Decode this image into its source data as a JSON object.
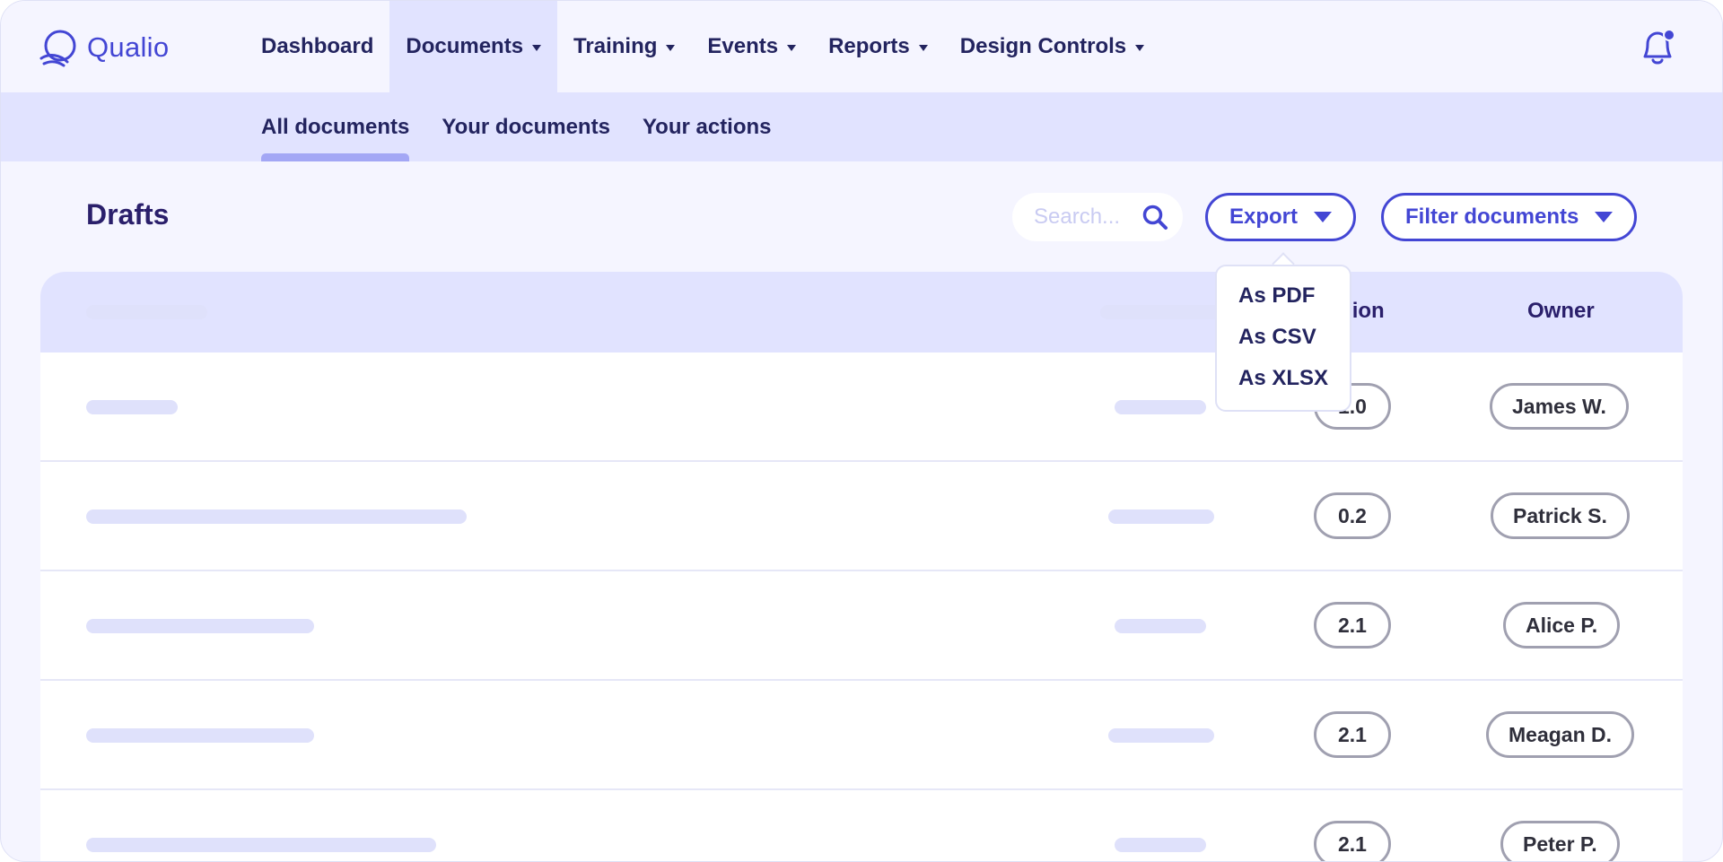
{
  "brand": {
    "name": "Qualio"
  },
  "nav": {
    "items": [
      {
        "label": "Dashboard",
        "has_caret": false,
        "active": false
      },
      {
        "label": "Documents",
        "has_caret": true,
        "active": true
      },
      {
        "label": "Training",
        "has_caret": true,
        "active": false
      },
      {
        "label": "Events",
        "has_caret": true,
        "active": false
      },
      {
        "label": "Reports",
        "has_caret": true,
        "active": false
      },
      {
        "label": "Design Controls",
        "has_caret": true,
        "active": false
      }
    ],
    "notification_icon": "bell-icon"
  },
  "subnav": {
    "tabs": [
      {
        "label": "All documents",
        "active": true
      },
      {
        "label": "Your documents",
        "active": false
      },
      {
        "label": "Your actions",
        "active": false
      }
    ]
  },
  "page": {
    "title": "Drafts"
  },
  "toolbar": {
    "search_placeholder": "Search...",
    "search_icon": "search-icon",
    "export_label": "Export",
    "filter_label": "Filter documents"
  },
  "export_menu": {
    "items": [
      "As PDF",
      "As CSV",
      "As XLSX"
    ]
  },
  "table": {
    "headers": {
      "version": "Version",
      "owner": "Owner"
    },
    "rows": [
      {
        "version": "1.0",
        "owner": "James W."
      },
      {
        "version": "0.2",
        "owner": "Patrick S."
      },
      {
        "version": "2.1",
        "owner": "Alice P."
      },
      {
        "version": "2.1",
        "owner": "Meagan D."
      },
      {
        "version": "2.1",
        "owner": "Peter P."
      }
    ]
  },
  "colors": {
    "accent": "#4346d4",
    "nav_text": "#23245f",
    "subnav_bg": "#e1e3ff",
    "page_bg": "#f5f5ff"
  }
}
